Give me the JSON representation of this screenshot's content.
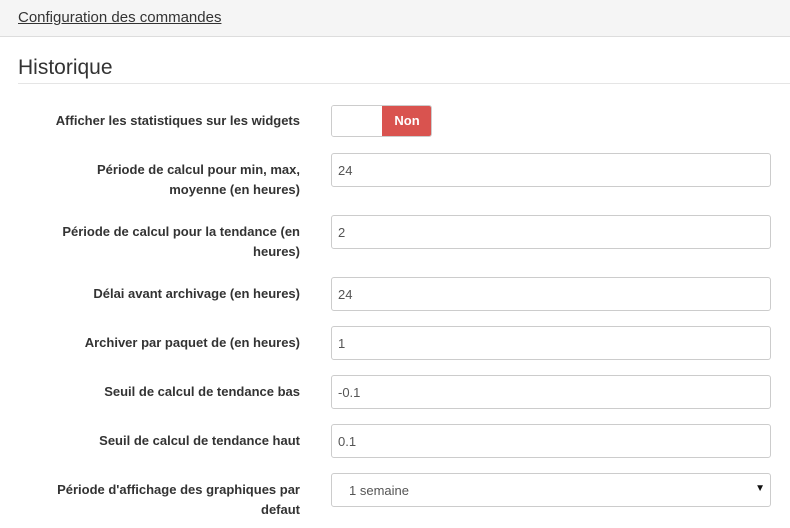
{
  "header": {
    "link": "Configuration des commandes"
  },
  "section": {
    "title": "Historique"
  },
  "fields": {
    "show_stats": {
      "label": "Afficher les statistiques sur les widgets",
      "state": "Non"
    },
    "calc_period": {
      "label_line1": "Période de calcul pour min, max,",
      "label_line2": "moyenne (en heures)",
      "value": "24"
    },
    "trend_period": {
      "label_line1": "Période de calcul pour la tendance (en",
      "label_line2": "heures)",
      "value": "2"
    },
    "archive_delay": {
      "label": "Délai avant archivage (en heures)",
      "value": "24"
    },
    "archive_batch": {
      "label": "Archiver par paquet de (en heures)",
      "value": "1"
    },
    "trend_low": {
      "label": "Seuil de calcul de tendance bas",
      "value": "-0.1"
    },
    "trend_high": {
      "label": "Seuil de calcul de tendance haut",
      "value": "0.1"
    },
    "graph_period": {
      "label_line1": "Période d'affichage des graphiques par",
      "label_line2": "defaut",
      "selected": "1 semaine"
    }
  },
  "icons": {
    "select_caret": "caret-down-icon"
  },
  "colors": {
    "toggle_off": "#d9534f",
    "header_bg": "#f5f5f5"
  }
}
